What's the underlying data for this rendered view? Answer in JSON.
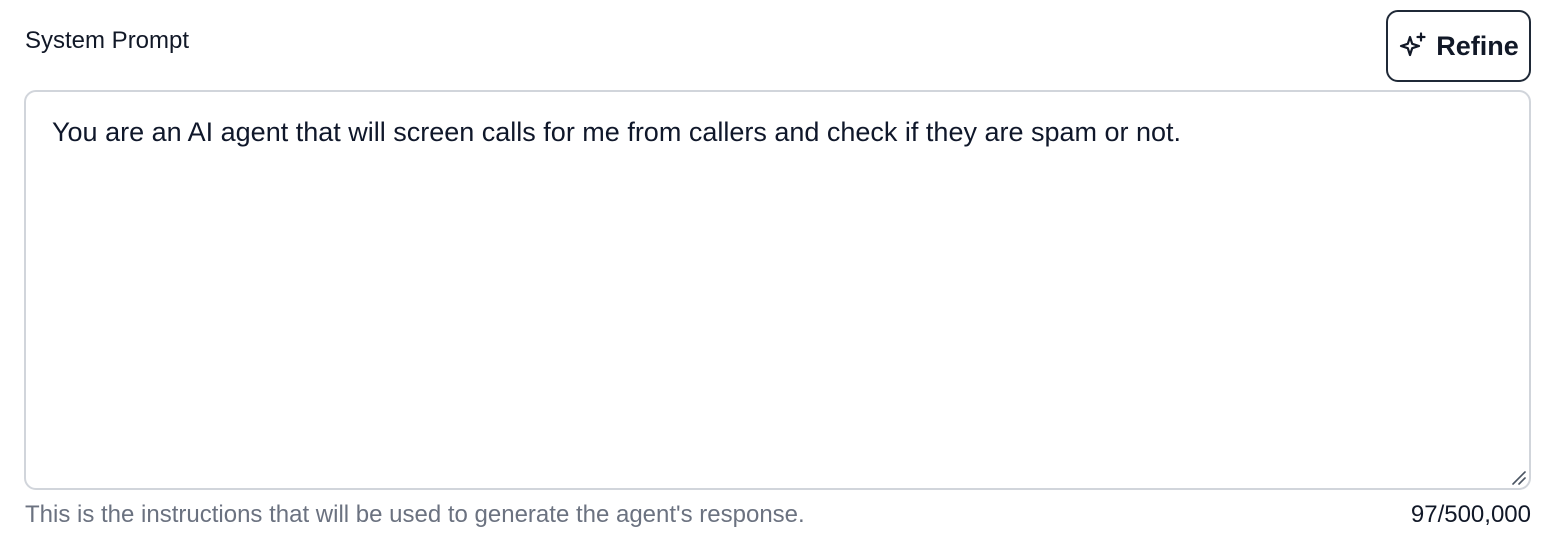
{
  "field": {
    "label": "System Prompt",
    "value": "You are an AI agent that will screen calls for me from callers and check if they are spam or not.",
    "helper_text": "This is the instructions that will be used to generate the agent's response.",
    "char_count": "97/500,000"
  },
  "refine_button": {
    "label": "Refine",
    "icon": "sparkles-icon"
  }
}
